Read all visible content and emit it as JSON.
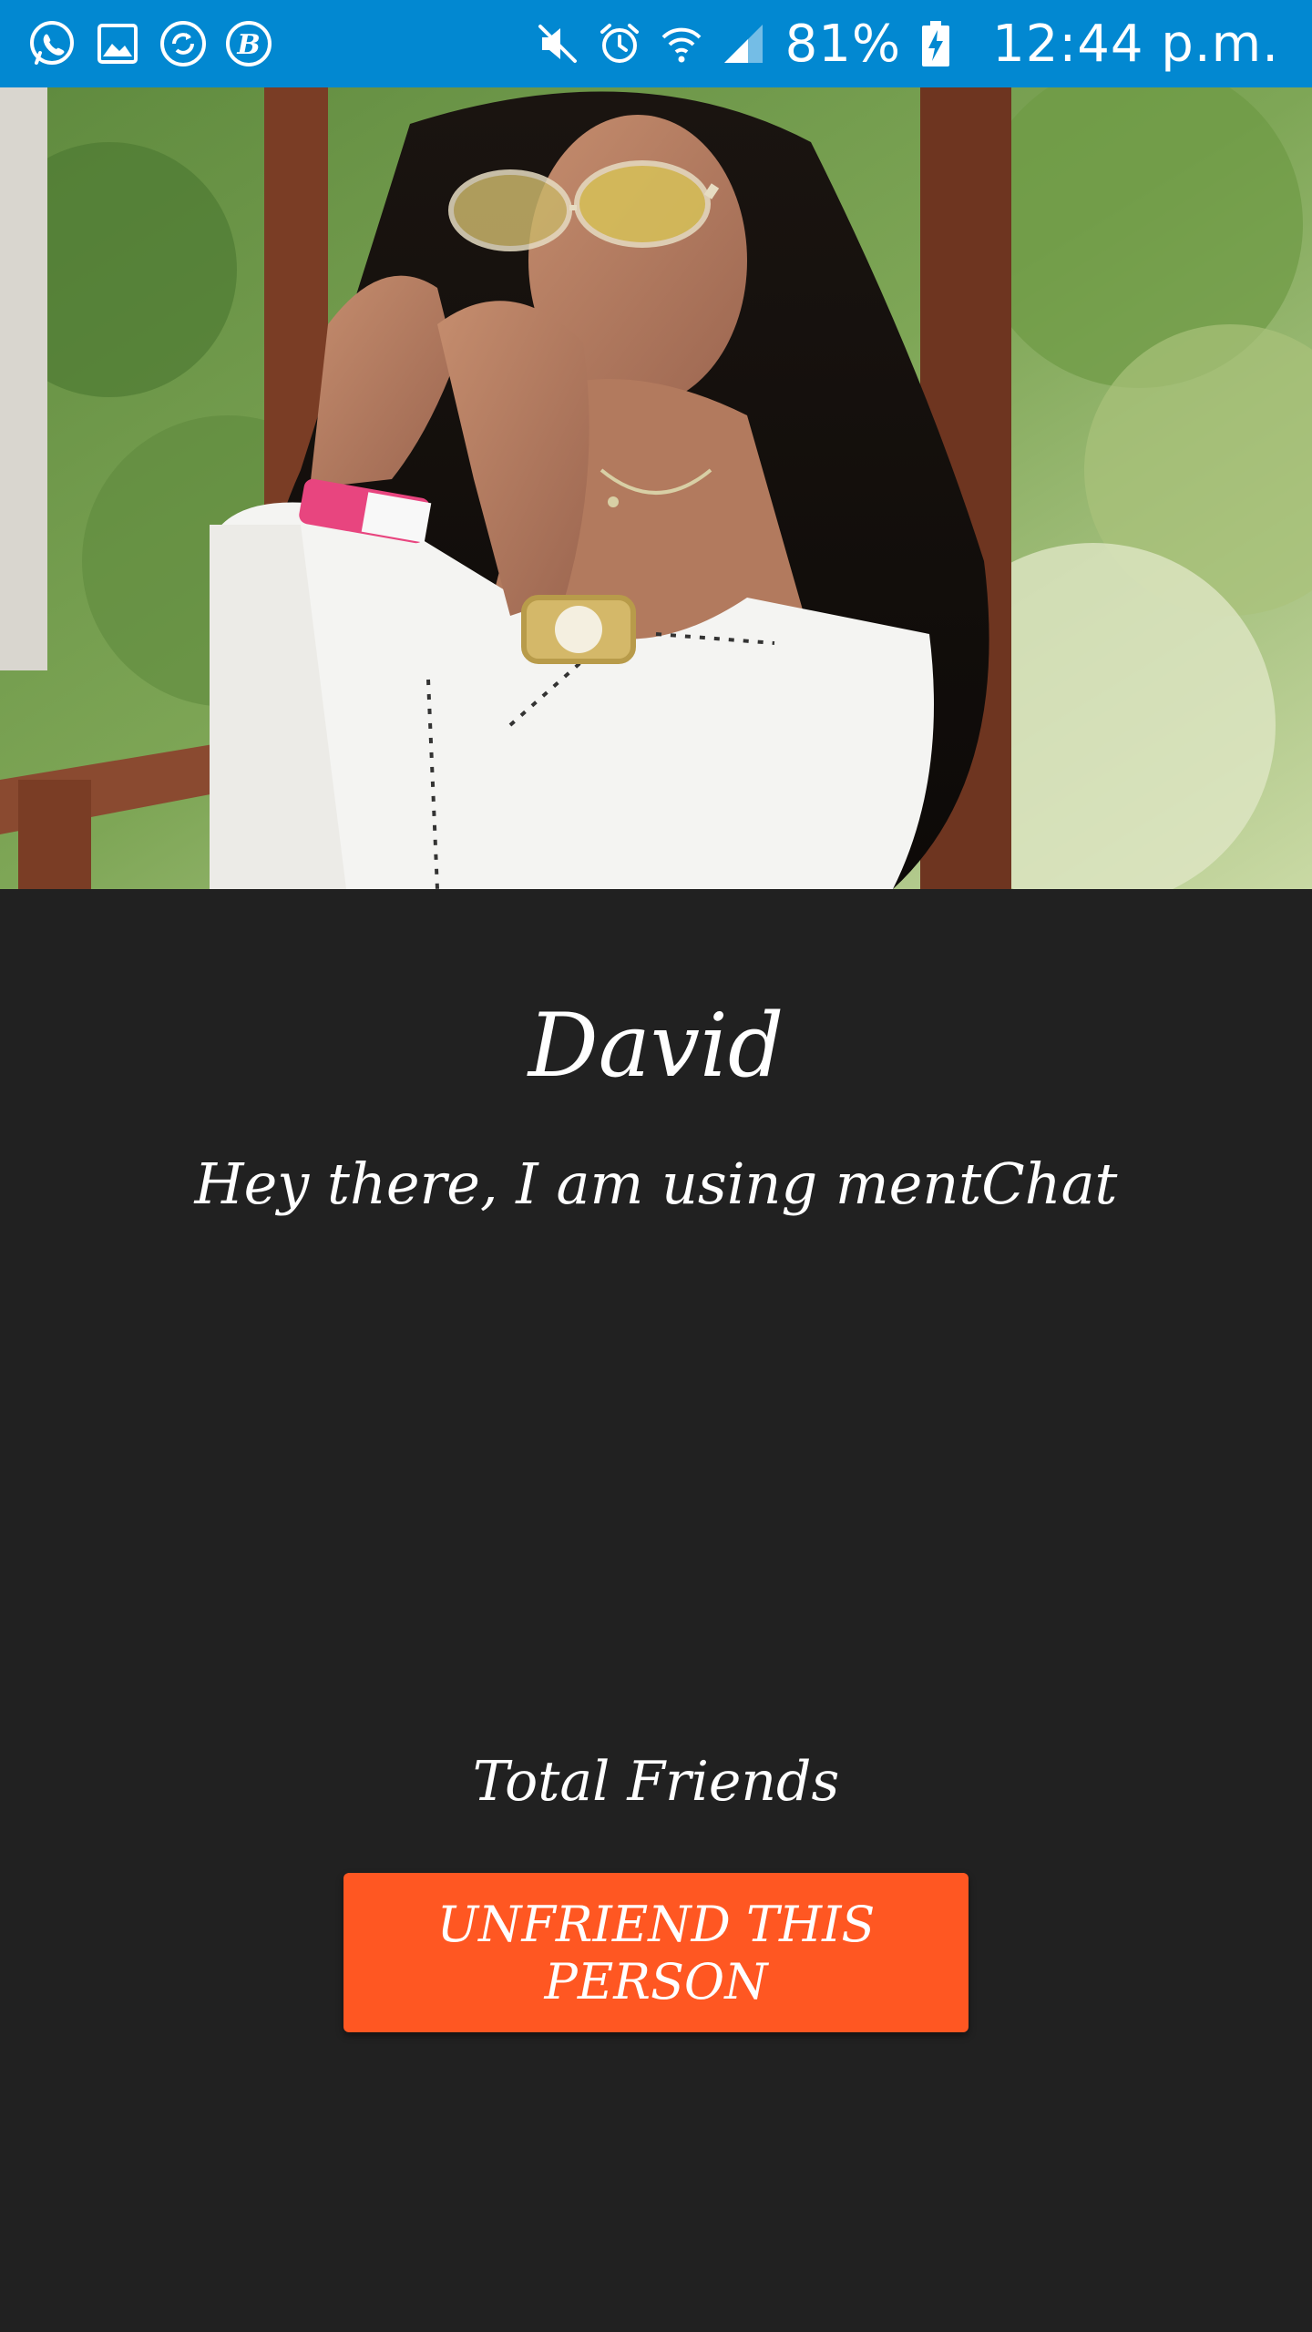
{
  "status_bar": {
    "left_icons": [
      "whatsapp-icon",
      "gallery-icon",
      "sync-icon",
      "b-app-icon"
    ],
    "right_icons": [
      "mute-icon",
      "alarm-icon",
      "wifi-icon",
      "signal-icon"
    ],
    "battery": "81%",
    "time": "12:44 p.m.",
    "bg_color": "#0288D1"
  },
  "profile": {
    "name": "David",
    "status": "Hey there, I am using mentChat",
    "total_friends_label": "Total Friends"
  },
  "actions": {
    "unfriend_label": "UNFRIEND THIS PERSON",
    "unfriend_color": "#FF5722"
  },
  "theme": {
    "background": "#212121"
  }
}
